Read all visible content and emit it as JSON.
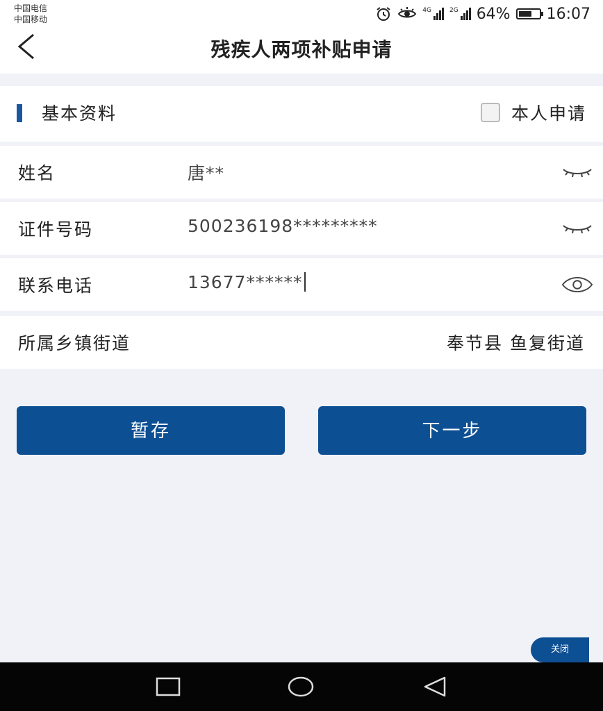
{
  "status_bar": {
    "carrier_1": "中国电信",
    "carrier_2": "中国移动",
    "signal_1_tag": "4G",
    "signal_2_tag": "2G",
    "battery_percent": "64%",
    "battery_level": 0.64,
    "time": "16:07",
    "icons": [
      "alarm-icon",
      "eye-comfort-icon",
      "signal-icon",
      "battery-icon"
    ]
  },
  "header": {
    "title": "残疾人两项补贴申请",
    "back_icon": "chevron-left-icon"
  },
  "section": {
    "title": "基本资料",
    "self_apply_label": "本人申请",
    "self_apply_checked": false
  },
  "form": {
    "rows": [
      {
        "label": "姓名",
        "value": "唐**",
        "toggle_icon": "eye-closed-icon"
      },
      {
        "label": "证件号码",
        "value": "500236198*********",
        "toggle_icon": "eye-closed-icon"
      },
      {
        "label": "联系电话",
        "value": "13677******",
        "toggle_icon": "eye-open-icon"
      },
      {
        "label": "所属乡镇街道",
        "value": "奉节县 鱼复街道"
      }
    ]
  },
  "buttons": {
    "save_label": "暂存",
    "next_label": "下一步"
  },
  "floating": {
    "close_label": "关闭"
  },
  "colors": {
    "primary": "#0d4f93",
    "accent_bar": "#1a57a3",
    "background": "#f0f2f7"
  },
  "android_nav": [
    "recent-apps-icon",
    "home-icon",
    "back-triangle-icon"
  ]
}
